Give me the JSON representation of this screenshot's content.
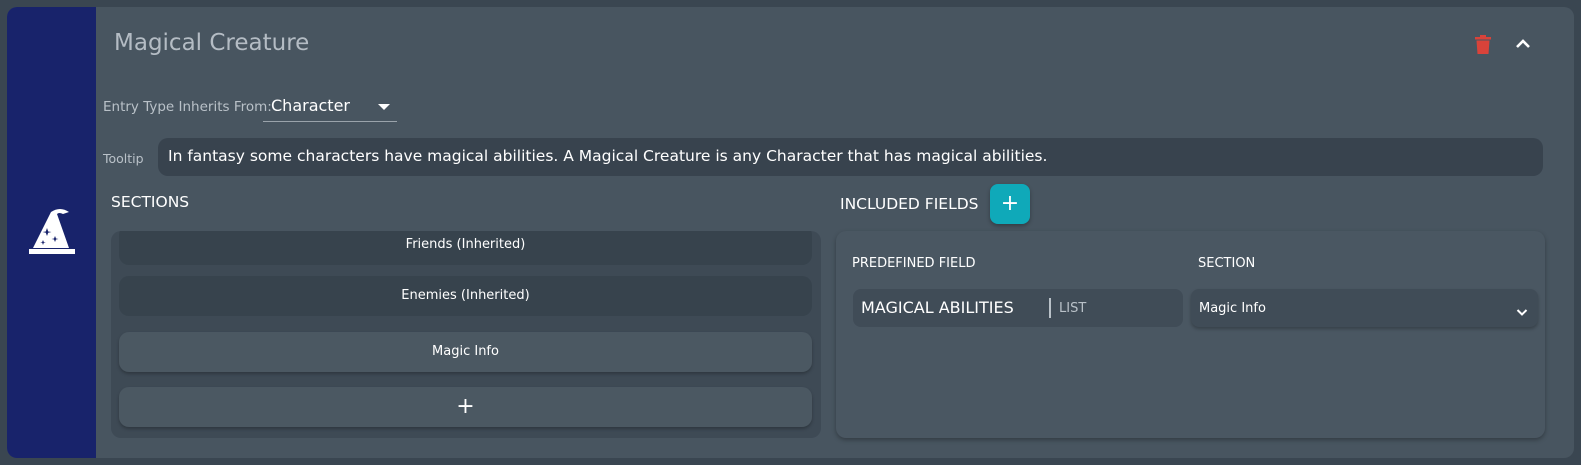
{
  "entry_type": {
    "title": "Magical Creature",
    "icon": "wizard-hat-icon",
    "delete_icon": "trash-icon",
    "collapse_icon": "chevron-up-icon"
  },
  "inherits": {
    "label": "Entry Type Inherits From:",
    "value": "Character"
  },
  "tooltip": {
    "label": "Tooltip",
    "value": "In fantasy some characters have magical abilities. A Magical Creature is any Character that has magical abilities."
  },
  "sections": {
    "heading": "SECTIONS",
    "items": [
      {
        "label": "Friends (Inherited)"
      },
      {
        "label": "Enemies (Inherited)"
      },
      {
        "label": "Magic Info"
      }
    ],
    "add_label": "+"
  },
  "included_fields": {
    "heading": "INCLUDED FIELDS",
    "add_label": "+",
    "columns": [
      "PREDEFINED FIELD",
      "SECTION"
    ],
    "rows": [
      {
        "field": "MAGICAL ABILITIES",
        "type": "LIST",
        "section": "Magic Info"
      }
    ]
  },
  "colors": {
    "accent": "#0fa9b9",
    "sidebar": "#18236b",
    "delete": "#d9433a"
  }
}
